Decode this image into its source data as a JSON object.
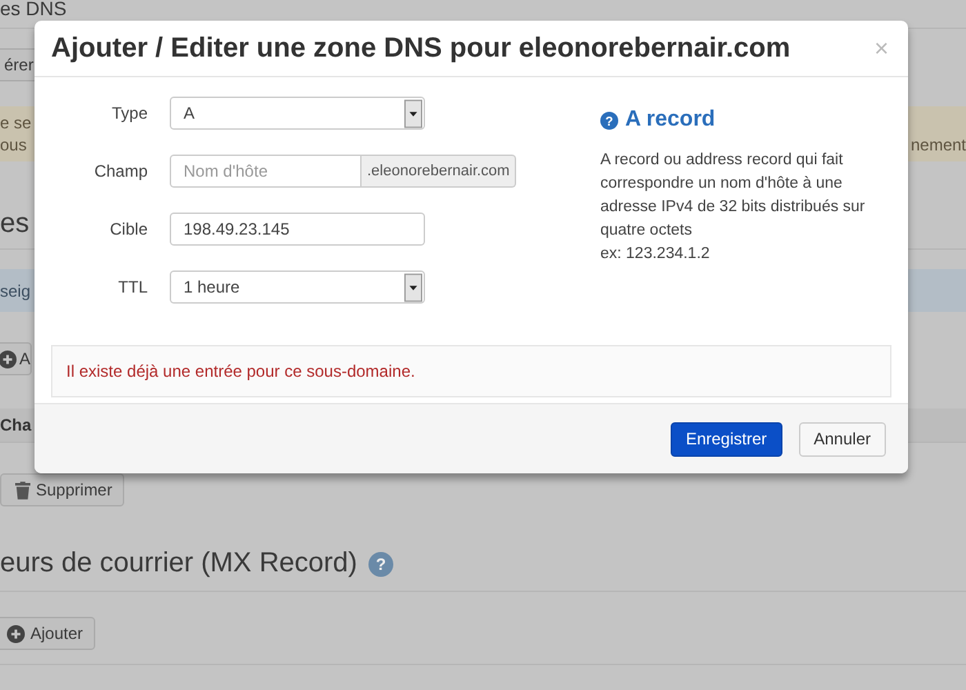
{
  "background_page": {
    "heading": "es DNS",
    "button": "érer",
    "alert": {
      "lines": [
        "e se",
        "ous"
      ],
      "trailing": "nement"
    },
    "section_heading": "es",
    "info_alert": "seig",
    "add_button": "A",
    "table": {
      "columns": [
        "Cha"
      ]
    },
    "delete_button": "Supprimer",
    "mx_heading": "eurs de courrier (MX Record)",
    "mx_help_icon": "?",
    "mx_add_button": "Ajouter"
  },
  "dialog": {
    "title": "Ajouter / Editer une zone DNS pour eleonorebernair.com",
    "close": "×",
    "fields": [
      {
        "kind": "select",
        "label": "Type",
        "value": "A"
      },
      {
        "kind": "addon",
        "label": "Champ",
        "placeholder": "Nom d'hôte",
        "addon": ".eleonorebernair.com"
      },
      {
        "kind": "text",
        "label": "Cible",
        "value": "198.49.23.145"
      },
      {
        "kind": "select",
        "label": "TTL",
        "value": "1 heure"
      }
    ],
    "help": {
      "icon": "?",
      "title": "A record",
      "text": "A record ou address record qui fait correspondre un nom d'hôte à une adresse IPv4 de 32 bits distribués sur quatre octets\nex: 123.234.1.2"
    },
    "error": "Il existe déjà une entrée pour ce sous-domaine.",
    "buttons": [
      {
        "label": "Enregistrer",
        "primary": true
      },
      {
        "label": "Annuler",
        "primary": false
      }
    ]
  }
}
